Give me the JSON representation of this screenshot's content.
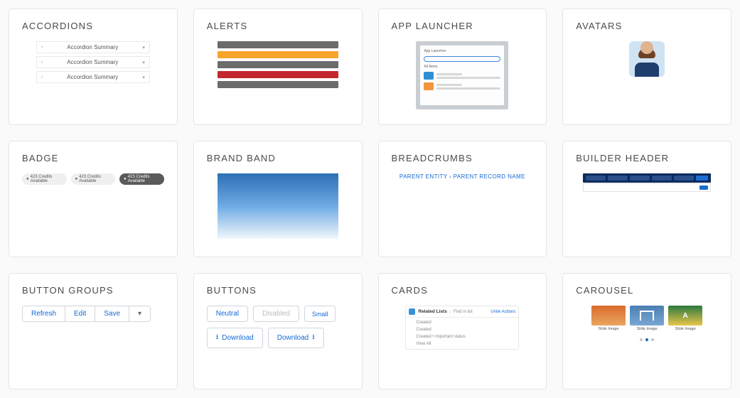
{
  "cards": {
    "accordions": {
      "title": "ACCORDIONS",
      "items": [
        "Accordion Summary",
        "Accordion Summary",
        "Accordion Summary"
      ]
    },
    "alerts": {
      "title": "ALERTS"
    },
    "app_launcher": {
      "title": "APP LAUNCHER",
      "header_label": "App Launcher",
      "section_label": "All Items"
    },
    "avatars": {
      "title": "AVATARS"
    },
    "badge": {
      "title": "BADGE",
      "labels": [
        "423 Credits Available",
        "423 Credits Available",
        "423 Credits Available"
      ]
    },
    "brand_band": {
      "title": "BRAND BAND"
    },
    "breadcrumbs": {
      "title": "BREADCRUMBS",
      "path": "PARENT ENTITY › PARENT RECORD NAME"
    },
    "builder_header": {
      "title": "BUILDER HEADER"
    },
    "button_groups": {
      "title": "BUTTON GROUPS",
      "buttons": [
        "Refresh",
        "Edit",
        "Save"
      ]
    },
    "buttons": {
      "title": "BUTTONS",
      "neutral": "Neutral",
      "disabled": "Disabled",
      "small": "Small",
      "download": "Download"
    },
    "cards_comp": {
      "title": "CARDS",
      "mini_title": "Related Lists",
      "search": "Find in list",
      "action": "Unite Actions",
      "lines": [
        "Created",
        "Created",
        "Created • important status",
        "View All"
      ]
    },
    "carousel": {
      "title": "CAROUSEL",
      "captions": [
        "Slide Image",
        "Slide Image",
        "Slide Image"
      ]
    }
  }
}
